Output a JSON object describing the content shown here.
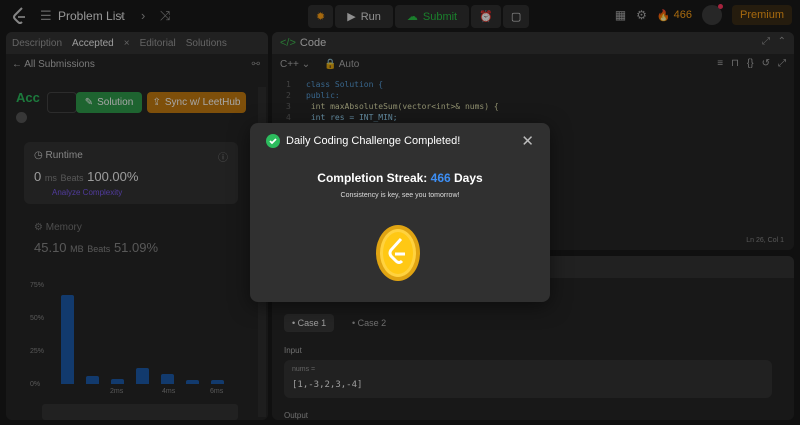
{
  "topbar": {
    "problem_list": "Problem List",
    "run_label": "Run",
    "submit_label": "Submit",
    "streak_count": "466",
    "premium_label": "Premium"
  },
  "left": {
    "tabs": [
      "Description",
      "Accepted",
      "Editorial",
      "Solutions"
    ],
    "all_submissions": "All Submissions",
    "status": "Acc",
    "solution_button": "Solution",
    "sync_button": "Sync w/ LeetHub",
    "runtime_title": "Runtime",
    "runtime_value": "0",
    "runtime_unit": "ms",
    "runtime_beats_label": "Beats",
    "runtime_beats": "100.00%",
    "analyze_label": "Analyze Complexity",
    "memory_title": "Memory",
    "memory_value": "45.10",
    "memory_unit": "MB",
    "memory_beats_label": "Beats",
    "memory_beats": "51.09%",
    "chart_ylabels": [
      "75%",
      "50%",
      "25%",
      "0%"
    ],
    "chart_xlabels": [
      "2ms",
      "4ms",
      "6ms"
    ]
  },
  "code": {
    "title": "Code",
    "language": "C++",
    "mode": "Auto",
    "lines": [
      {
        "n": "1",
        "t": "class Solution {"
      },
      {
        "n": "2",
        "t": "public:"
      },
      {
        "n": "3",
        "t": "    int maxAbsoluteSum(vector<int>& nums) {"
      },
      {
        "n": "4",
        "t": "        int res = INT_MIN;"
      }
    ],
    "cursor": "Ln 26, Col 1"
  },
  "tests": {
    "case1": "Case 1",
    "case2": "Case 2",
    "input_label": "Input",
    "input_name": "nums =",
    "input_value": "[1,-3,2,3,-4]",
    "output_label": "Output"
  },
  "modal": {
    "title": "Daily Coding Challenge Completed!",
    "streak_prefix": "Completion Streak:",
    "streak_count": "466",
    "streak_suffix": "Days",
    "message": "Consistency is key, see you tomorrow!"
  },
  "chart_data": {
    "type": "bar",
    "values": [
      68,
      6,
      4,
      12,
      8,
      3,
      3
    ],
    "ylim": [
      0,
      75
    ]
  }
}
